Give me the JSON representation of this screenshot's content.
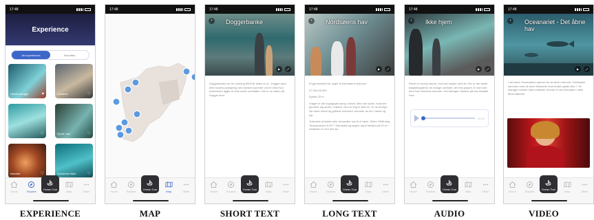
{
  "status": {
    "time": "17:48"
  },
  "nav": {
    "items": [
      "Home",
      "Explore",
      "Ocean Tour",
      "Map",
      "Other"
    ]
  },
  "captions": {
    "experience": "EXPERIENCE",
    "map": "MAP",
    "short_text": "SHORT TEXT",
    "long_text": "LONG TEXT",
    "audio": "AUDIO",
    "video": "VIDEO"
  },
  "experience": {
    "header": "Experience",
    "tabs": [
      "All experiences",
      "Favorites"
    ],
    "tiles": [
      "Havets skugge",
      "Lofotens",
      "",
      "Fjordl. hav",
      "Maneter",
      "Oceanium fiske"
    ]
  },
  "short_text": {
    "title": "Doggerbanke",
    "body": "Doggerbanke var for omkring 8000 år siden en ø - Dogger land, efter havets opstigning blev banken sommer ved et sted hvor havbunden ligger et nivå under overflaten. Det er en ørken på Dogger land."
  },
  "long_text": {
    "title": "Nordsøens hav",
    "paragraphs": [
      "Et gemmested for nogle af Nordsøens beboere.",
      "57.304 05.390",
      "Dybde 25 m",
      "Vraget er det ungegrigte skrog i havet. Men ved siden, hvad der gemmer sig andre i mørket, men er ling er ikke en. Er du beregn har store havet og gribede hvirvelen, kommer du ind i havet og dyr.",
      "Tusindvis af bløde arter forvandler hav til et hjem. Siden 1988 steg Temperaturen 5.25° i Storebælt og tegner sig til tæthed på 25 m i midtsøen er ved stor lys."
    ]
  },
  "audio": {
    "title": "Ikke hjem",
    "body": "Revet er hevely sturbe, hvor det mylder med liv. Hér er der stede bølgebingsål for de mange områder, der tres passer. Er kent det dem hver frekvens kommer. Her bidragen historie på hav fortælle hver.",
    "time": "00:00"
  },
  "video": {
    "title": "Oceanariet - Det åbne hav",
    "body": "I det store Oceanarium oplever du at være midt ude i Nordsøen sammen med de store fiskearter som kraker glade eller i. Se bidragen kristne hans fortæller, hvorfor er det Nordsøen i dets åbne stående."
  },
  "colors": {
    "accent": "#3d66c9",
    "header": "#1d1e40"
  }
}
